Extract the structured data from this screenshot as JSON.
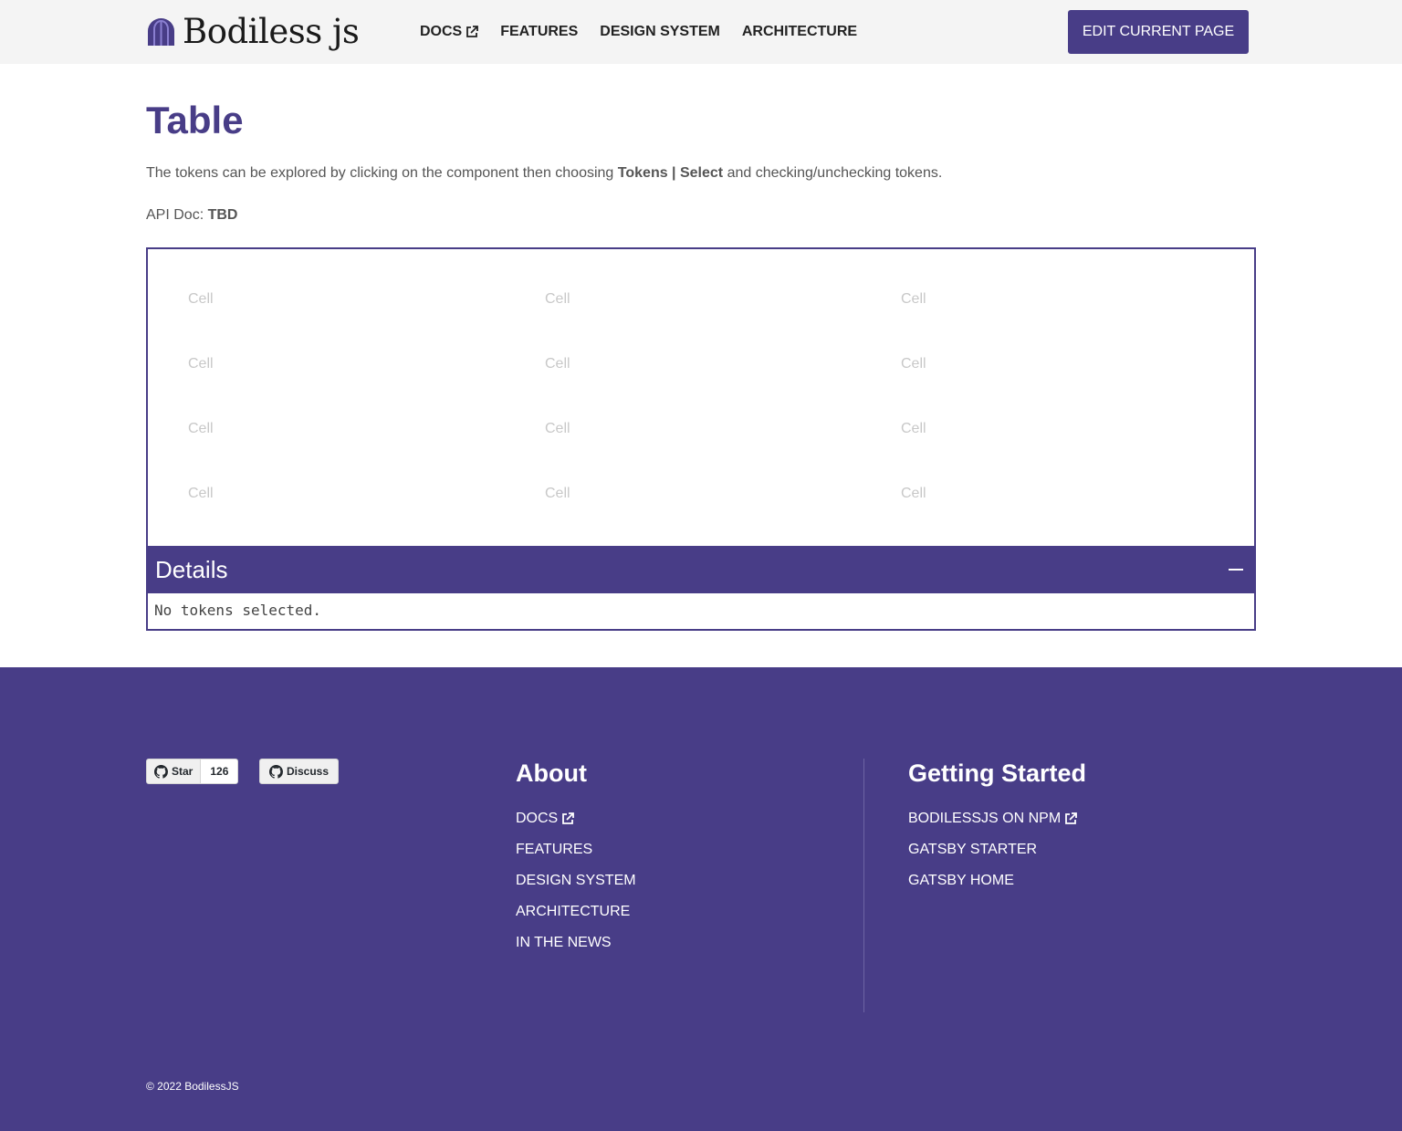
{
  "header": {
    "logo_text": "Bodiless js",
    "nav": [
      {
        "label": "DOCS",
        "external": true
      },
      {
        "label": "FEATURES",
        "external": false
      },
      {
        "label": "DESIGN SYSTEM",
        "external": false
      },
      {
        "label": "ARCHITECTURE",
        "external": false
      }
    ],
    "edit_button": "EDIT CURRENT PAGE"
  },
  "main": {
    "title": "Table",
    "intro_prefix": "The tokens can be explored by clicking on  the component then choosing ",
    "intro_bold": "Tokens | Select",
    "intro_suffix": " and checking/unchecking tokens.",
    "api_label": "API Doc: ",
    "api_value": "TBD",
    "table": {
      "rows": [
        [
          "Cell",
          "Cell",
          "Cell"
        ],
        [
          "Cell",
          "Cell",
          "Cell"
        ],
        [
          "Cell",
          "Cell",
          "Cell"
        ],
        [
          "Cell",
          "Cell",
          "Cell"
        ]
      ]
    },
    "details": {
      "title": "Details",
      "body": "No tokens selected."
    }
  },
  "footer": {
    "github_star": {
      "label": "Star",
      "count": "126"
    },
    "github_discuss": {
      "label": "Discuss"
    },
    "about": {
      "title": "About",
      "links": [
        {
          "label": "DOCS",
          "external": true
        },
        {
          "label": "FEATURES",
          "external": false
        },
        {
          "label": "DESIGN SYSTEM",
          "external": false
        },
        {
          "label": "ARCHITECTURE",
          "external": false
        },
        {
          "label": "IN THE NEWS",
          "external": false
        }
      ]
    },
    "getting_started": {
      "title": "Getting Started",
      "links": [
        {
          "label": "BODILESSJS ON NPM",
          "external": true
        },
        {
          "label": "GATSBY STARTER",
          "external": false
        },
        {
          "label": "GATSBY HOME",
          "external": false
        }
      ]
    },
    "copyright": "©  2022 BodilessJS"
  },
  "colors": {
    "brand": "#483d87",
    "header_bg": "#f4f4f4",
    "cell_text": "#c8c8c8"
  },
  "icons": [
    "logo-mark-icon",
    "external-link-icon",
    "minus-icon",
    "github-icon"
  ]
}
